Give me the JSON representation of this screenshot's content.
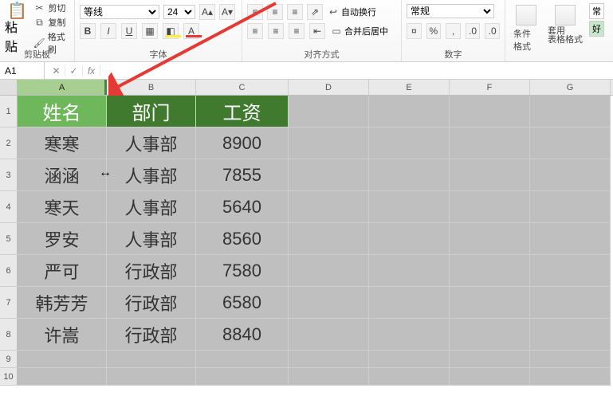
{
  "ribbon": {
    "clipboard": {
      "paste": "粘贴",
      "cut": "剪切",
      "copy": "复制",
      "painter": "格式刷",
      "label": "剪贴板"
    },
    "font": {
      "name": "等线",
      "size": "24",
      "bold": "B",
      "italic": "I",
      "underline": "U",
      "label": "字体"
    },
    "align": {
      "wrap": "自动换行",
      "merge": "合并后居中",
      "label": "对齐方式"
    },
    "number": {
      "format": "常规",
      "label": "数字"
    },
    "styles": {
      "condfmt": "条件格式",
      "tablefmt": "套用\n表格格式",
      "good": "好",
      "normal": "常"
    }
  },
  "namebox": {
    "ref": "A1",
    "fx": "fx"
  },
  "cols": {
    "A": "A",
    "B": "B",
    "C": "C",
    "D": "D",
    "E": "E",
    "F": "F",
    "G": "G"
  },
  "rows": [
    "1",
    "2",
    "3",
    "4",
    "5",
    "6",
    "7",
    "8",
    "9",
    "10"
  ],
  "headers": {
    "name": "姓名",
    "dept": "部门",
    "salary": "工资"
  },
  "data": [
    {
      "name": "寒寒",
      "dept": "人事部",
      "salary": "8900"
    },
    {
      "name": "涵涵",
      "dept": "人事部",
      "salary": "7855"
    },
    {
      "name": "寒天",
      "dept": "人事部",
      "salary": "5640"
    },
    {
      "name": "罗安",
      "dept": "人事部",
      "salary": "8560"
    },
    {
      "name": "严可",
      "dept": "行政部",
      "salary": "7580"
    },
    {
      "name": "韩芳芳",
      "dept": "行政部",
      "salary": "6580"
    },
    {
      "name": "许嵩",
      "dept": "行政部",
      "salary": "8840"
    }
  ],
  "chart_data": {
    "type": "table",
    "columns": [
      "姓名",
      "部门",
      "工资"
    ],
    "rows": [
      [
        "寒寒",
        "人事部",
        8900
      ],
      [
        "涵涵",
        "人事部",
        7855
      ],
      [
        "寒天",
        "人事部",
        5640
      ],
      [
        "罗安",
        "人事部",
        8560
      ],
      [
        "严可",
        "行政部",
        7580
      ],
      [
        "韩芳芳",
        "行政部",
        6580
      ],
      [
        "许嵩",
        "行政部",
        8840
      ]
    ]
  }
}
